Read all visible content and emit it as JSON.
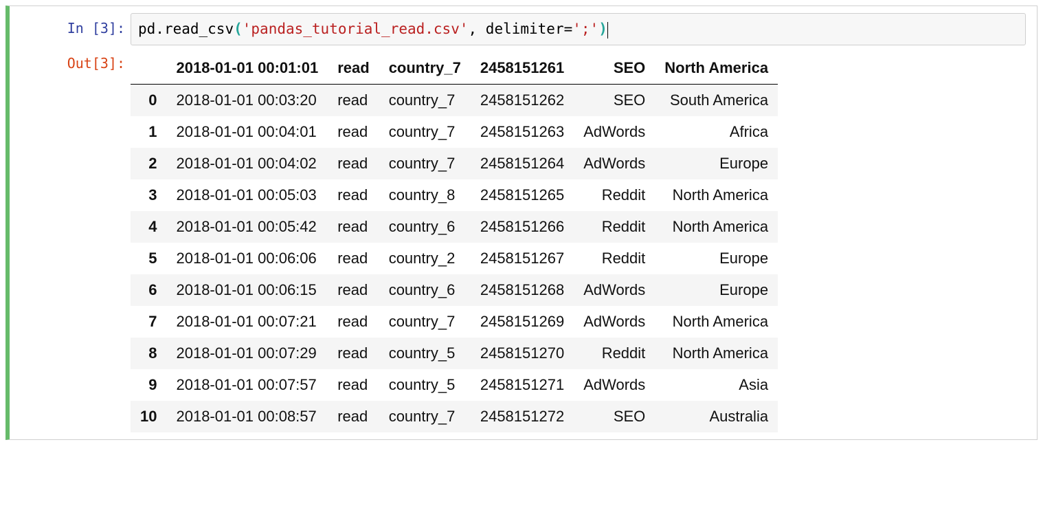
{
  "cell": {
    "input_prompt": "In [3]:",
    "output_prompt": "Out[3]:",
    "code": {
      "t1": "pd",
      "t2": ".",
      "t3": "read_csv",
      "t4": "(",
      "t5": "'pandas_tutorial_read.csv'",
      "t6": ", ",
      "t7": "delimiter",
      "t8": "=",
      "t9": "';'",
      "t10": ")"
    }
  },
  "dataframe": {
    "headers": [
      "2018-01-01 00:01:01",
      "read",
      "country_7",
      "2458151261",
      "SEO",
      "North America"
    ],
    "index": [
      "0",
      "1",
      "2",
      "3",
      "4",
      "5",
      "6",
      "7",
      "8",
      "9",
      "10"
    ],
    "rows": [
      [
        "2018-01-01 00:03:20",
        "read",
        "country_7",
        "2458151262",
        "SEO",
        "South America"
      ],
      [
        "2018-01-01 00:04:01",
        "read",
        "country_7",
        "2458151263",
        "AdWords",
        "Africa"
      ],
      [
        "2018-01-01 00:04:02",
        "read",
        "country_7",
        "2458151264",
        "AdWords",
        "Europe"
      ],
      [
        "2018-01-01 00:05:03",
        "read",
        "country_8",
        "2458151265",
        "Reddit",
        "North America"
      ],
      [
        "2018-01-01 00:05:42",
        "read",
        "country_6",
        "2458151266",
        "Reddit",
        "North America"
      ],
      [
        "2018-01-01 00:06:06",
        "read",
        "country_2",
        "2458151267",
        "Reddit",
        "Europe"
      ],
      [
        "2018-01-01 00:06:15",
        "read",
        "country_6",
        "2458151268",
        "AdWords",
        "Europe"
      ],
      [
        "2018-01-01 00:07:21",
        "read",
        "country_7",
        "2458151269",
        "AdWords",
        "North America"
      ],
      [
        "2018-01-01 00:07:29",
        "read",
        "country_5",
        "2458151270",
        "Reddit",
        "North America"
      ],
      [
        "2018-01-01 00:07:57",
        "read",
        "country_5",
        "2458151271",
        "AdWords",
        "Asia"
      ],
      [
        "2018-01-01 00:08:57",
        "read",
        "country_7",
        "2458151272",
        "SEO",
        "Australia"
      ]
    ]
  }
}
